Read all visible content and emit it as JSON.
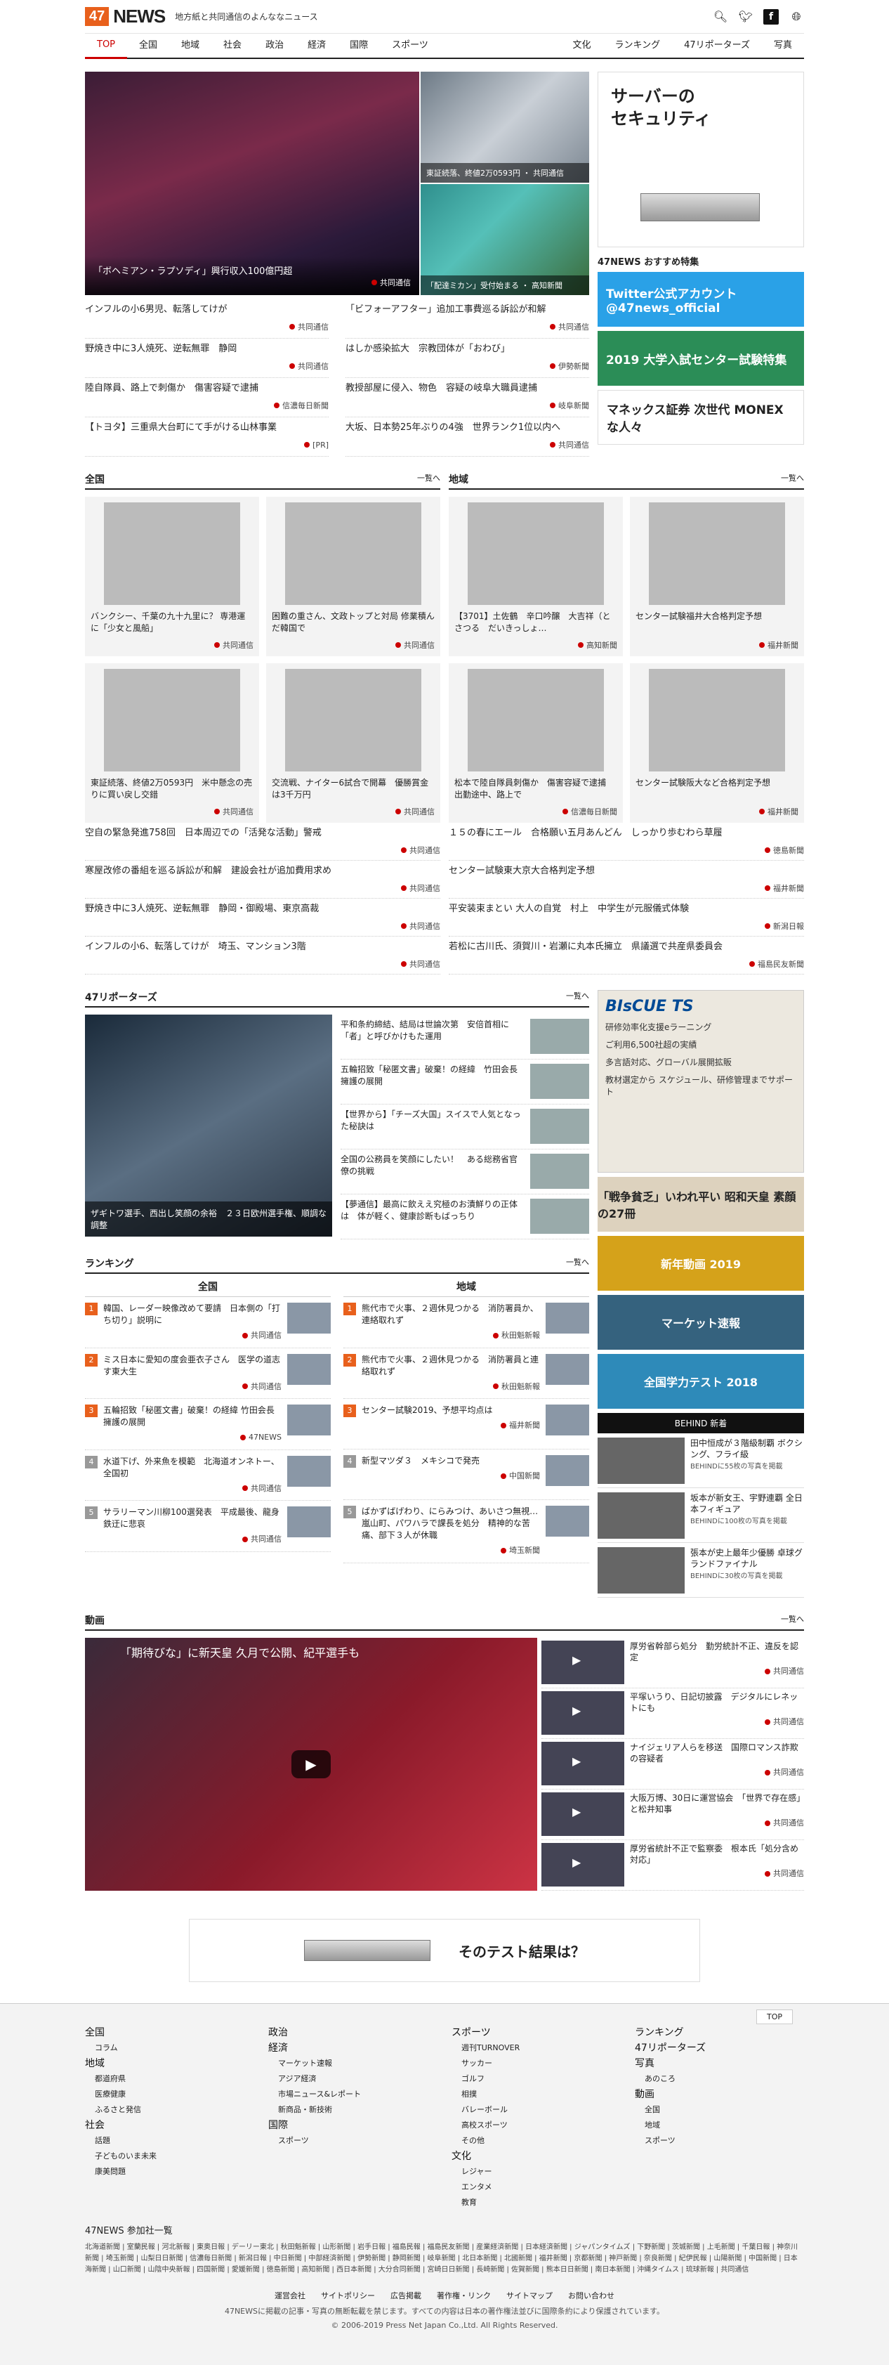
{
  "header": {
    "logo_mark": "47",
    "logo_word": "NEWS",
    "tagline": "地方紙と共同通信のよんななニュース",
    "icons": [
      "search-icon",
      "twitter-icon",
      "facebook-icon",
      "globe-icon"
    ]
  },
  "nav": {
    "items": [
      "TOP",
      "全国",
      "地域",
      "社会",
      "政治",
      "経済",
      "国際",
      "スポーツ"
    ],
    "right": [
      "文化",
      "ランキング",
      "47リポーターズ",
      "写真"
    ]
  },
  "hero": {
    "main": {
      "caption": "「ボヘミアン・ラプソディ」興行収入100億円超",
      "source": "共同通信"
    },
    "sub": [
      {
        "caption": "東証続落、終値2万0593円",
        "source": "共同通信"
      },
      {
        "caption": "「配達ミカン」受付始まる",
        "source": "高知新聞"
      }
    ]
  },
  "top_news": [
    {
      "title": "インフルの小6男児、転落してけが",
      "source": "共同通信"
    },
    {
      "title": "「ビフォーアフター」追加工事費巡る訴訟が和解",
      "source": "共同通信"
    },
    {
      "title": "野焼き中に3人焼死、逆転無罪　静岡",
      "source": "共同通信"
    },
    {
      "title": "はしか感染拡大　宗教団体が「おわび」",
      "source": "伊勢新聞"
    },
    {
      "title": "陸自隊員、路上で刺傷か　傷害容疑で逮捕",
      "source": "信濃毎日新聞"
    },
    {
      "title": "教授部屋に侵入、物色　容疑の岐阜大職員逮捕",
      "source": "岐阜新聞"
    },
    {
      "title": "【トヨタ】三重県大台町にて手がける山林事業",
      "source": "[PR]"
    },
    {
      "title": "大坂、日本勢25年ぶりの4強　世界ランク1位以内へ",
      "source": "共同通信"
    }
  ],
  "ad_right": {
    "line1": "サーバーの",
    "line2": "セキュリティ"
  },
  "features": {
    "heading": "47NEWS おすすめ特集",
    "items": [
      "Twitter公式アカウント @47news_official",
      "2019 大学入試センター試験特集",
      "マネックス証券 次世代 MONEXな人々"
    ]
  },
  "zenkoku": {
    "title": "全国",
    "more": "一覧へ",
    "cards": [
      {
        "title": "バンクシー、千葉の九十九里に？ 専港運に「少女と風船」",
        "source": "共同通信"
      },
      {
        "title": "困難の重さん、文政トップと対局 修業積んだ韓国で",
        "source": "共同通信"
      },
      {
        "title": "東証続落、終値2万0593円　米中懸念の売りに買い戻し交錯",
        "source": "共同通信"
      },
      {
        "title": "交流戦、ナイター6試合で開幕　優勝賞金は3千万円",
        "source": "共同通信"
      }
    ],
    "list": [
      {
        "title": "空自の緊急発進758回　日本周辺での「活発な活動」警戒",
        "source": "共同通信"
      },
      {
        "title": "寒屋改修の番組を巡る訴訟が和解　建設会社が追加費用求め",
        "source": "共同通信"
      },
      {
        "title": "野焼き中に3人焼死、逆転無罪　静岡・御殿場、東京高裁",
        "source": "共同通信"
      },
      {
        "title": "インフルの小6、転落してけが　埼玉、マンション3階",
        "source": "共同通信"
      }
    ]
  },
  "chiiki": {
    "title": "地域",
    "more": "一覧へ",
    "cards": [
      {
        "title": "【3701】土佐鶴　辛口吟醸　大吉祥（とさつる　だいきっしょ…",
        "source": "高知新聞"
      },
      {
        "title": "センター試験福井大合格判定予想",
        "source": "福井新聞"
      },
      {
        "title": "松本で陸自隊員刺傷か　傷害容疑で逮捕　出勤途中、路上で",
        "source": "信濃毎日新聞"
      },
      {
        "title": "センター試験阪大など合格判定予想",
        "source": "福井新聞"
      }
    ],
    "list": [
      {
        "title": "１５の春にエール　合格願い五月あんどん　しっかり歩むわら草履",
        "source": "徳島新聞"
      },
      {
        "title": "センター試験東大京大合格判定予想",
        "source": "福井新聞"
      },
      {
        "title": "平安装束まとい 大人の自覚　村上　中学生が元服儀式体験",
        "source": "新潟日報"
      },
      {
        "title": "若松に古川氏、須賀川・岩瀬に丸本氏擁立　県議選で共産県委員会",
        "source": "福島民友新聞"
      }
    ]
  },
  "reporters": {
    "title": "47リポーターズ",
    "more": "一覧へ",
    "main_caption": "ザギトワ選手、西出し笑顔の余裕　２３日欧州選手権、順調な調整",
    "items": [
      "平和条約締結、結局は世論次第　安倍首相に「者」と呼びかけもた運用",
      "五輪招致「秘匿文書」破棄！の経緯　竹田会長擁護の展開",
      "【世界から】「チーズ大国」スイスで人気となった秘訣は",
      "全国の公務員を笑顔にしたい！　ある総務省官僚の挑戦",
      "【夢通信】最高に飲ええ究極のお漬鮮りの正体は　体が軽く、健康診断もばっちり"
    ]
  },
  "ranking": {
    "title": "ランキング",
    "more": "一覧へ",
    "col1": "全国",
    "col2": "地域",
    "zenkoku": [
      {
        "n": "1",
        "title": "韓国、レーダー映像改めて要請　日本側の「打ち切り」説明に",
        "source": "共同通信"
      },
      {
        "n": "2",
        "title": "ミス日本に愛知の度会亜衣子さん　医学の道志す東大生",
        "source": "共同通信"
      },
      {
        "n": "3",
        "title": "五輪招致「秘匿文書」破棄！の経緯 竹田会長擁護の展開",
        "source": "47NEWS"
      },
      {
        "n": "4",
        "title": "水道下げ、外来魚を模範　北海道オンネトー、全国初",
        "source": "共同通信"
      },
      {
        "n": "5",
        "title": "サラリーマン川柳100選発表　平成最後、龍身鉄迂に悲哀",
        "source": "共同通信"
      }
    ],
    "chiiki": [
      {
        "n": "1",
        "title": "熊代市で火事、２週休見つかる　消防署員か、連絡取れず",
        "source": "秋田魁新報"
      },
      {
        "n": "2",
        "title": "熊代市で火事、２週休見つかる　消防署員と連絡取れず",
        "source": "秋田魁新報"
      },
      {
        "n": "3",
        "title": "センター試験2019、予想平均点は",
        "source": "福井新聞"
      },
      {
        "n": "4",
        "title": "新型マツダ３　メキシコで発売",
        "source": "中国新聞"
      },
      {
        "n": "5",
        "title": "ばかずばげわり、にらみつけ、あいさつ無視…嵐山町、パワハラで課長を処分　精神的な苦痛、部下３人が休職",
        "source": "埼玉新聞"
      }
    ]
  },
  "sidebar": {
    "ad_title": "BIsCUE TS",
    "ad_lines": [
      "研修効率化支援eラーニング",
      "ご利用6,500社超の実績",
      "多言語対応、グローバル展開拡販",
      "教材選定から スケジュール、研修管理までサポート"
    ],
    "banners": [
      "「戦争貧乏」いわれ平い 昭和天皇 素顔の27冊",
      "新年動画 2019",
      "マーケット速報",
      "全国学力テスト 2018"
    ],
    "behind_title": "BEHIND 新着",
    "behind": [
      {
        "title": "田中恒成が３階級制覇 ボクシング、フライ級",
        "sub": "BEHINDに55枚の写真を掲載"
      },
      {
        "title": "坂本が新女王、宇野連覇 全日本フィギュア",
        "sub": "BEHINDに100枚の写真を掲載"
      },
      {
        "title": "張本が史上最年少優勝 卓球グランドファイナル",
        "sub": "BEHINDに30枚の写真を掲載"
      }
    ]
  },
  "video": {
    "title": "動画",
    "more": "一覧へ",
    "main_title": "「期待びな」に新天皇 久月で公開、紀平選手も",
    "items": [
      {
        "title": "厚労省幹部ら処分　勤労統計不正、違反を認定",
        "source": "共同通信"
      },
      {
        "title": "平塚いうり、日記切披露　デジタルにレネットにも",
        "source": "共同通信"
      },
      {
        "title": "ナイジェリア人らを移送　国際ロマンス詐欺の容疑者",
        "source": "共同通信"
      },
      {
        "title": "大阪万博、30日に運営協会　「世界で存在感」と松井知事",
        "source": "共同通信"
      },
      {
        "title": "厚労省統計不正で監察委　根本氏「処分含め対応」",
        "source": "共同通信"
      }
    ]
  },
  "bottom_ad": "そのテスト結果は？",
  "footer": {
    "to_top": "TOP",
    "cols": [
      {
        "h": [
          "全国",
          "地域",
          "社会"
        ],
        "c": [
          [
            "コラム"
          ],
          [
            "都道府県",
            "医療健康",
            "ふるさと発信"
          ],
          [
            "話題",
            "子どものいま未来",
            "康美問題"
          ]
        ]
      },
      {
        "h": [
          "政治",
          "経済",
          "国際"
        ],
        "c": [
          [],
          [
            "マーケット速報",
            "アジア経済",
            "市場ニュース&レポート",
            "新商品・新技術"
          ],
          [
            "スポーツ"
          ]
        ]
      },
      {
        "h": [
          "スポーツ",
          "文化"
        ],
        "c": [
          [
            "週刊TURNOVER",
            "サッカー",
            "ゴルフ",
            "相撲",
            "バレーボール",
            "高校スポーツ",
            "その他"
          ],
          [
            "レジャー",
            "エンタメ",
            "教育"
          ]
        ]
      },
      {
        "h": [
          "ランキング",
          "47リポーターズ",
          "写真",
          "動画"
        ],
        "c": [
          [],
          [],
          [
            "あのころ"
          ],
          [
            "全国",
            "地域",
            "スポーツ"
          ]
        ]
      }
    ],
    "partners_title": "47NEWS 参加社一覧",
    "partners": "北海道新聞 | 室蘭民報 | 河北新報 | 東奥日報 | デーリー東北 | 秋田魁新報 | 山形新聞 | 岩手日報 | 福島民報 | 福島民友新聞 | 産業経済新聞 | 日本経済新聞 | ジャパンタイムズ | 下野新聞 | 茨城新聞 | 上毛新聞 | 千葉日報 | 神奈川新聞 | 埼玉新聞 | 山梨日日新聞 | 信濃毎日新聞 | 新潟日報 | 中日新聞 | 中部経済新聞 | 伊勢新聞 | 静岡新聞 | 岐阜新聞 | 北日本新聞 | 北國新聞 | 福井新聞 | 京都新聞 | 神戸新聞 | 奈良新聞 | 紀伊民報 | 山陽新聞 | 中国新聞 | 日本海新聞 | 山口新聞 | 山陰中央新報 | 四国新聞 | 愛媛新聞 | 徳島新聞 | 高知新聞 | 西日本新聞 | 大分合同新聞 | 宮崎日日新聞 | 長崎新聞 | 佐賀新聞 | 熊本日日新聞 | 南日本新聞 | 沖縄タイムス | 琉球新報 | 共同通信",
    "links": [
      "運営会社",
      "サイトポリシー",
      "広告掲載",
      "著作権・リンク",
      "サイトマップ",
      "お問い合わせ"
    ],
    "notice": "47NEWSに掲載の記事・写真の無断転載を禁じます。すべての内容は日本の著作権法並びに国際条約により保護されています。",
    "copyright": "© 2006-2019 Press Net Japan Co.,Ltd. All Rights Reserved."
  }
}
